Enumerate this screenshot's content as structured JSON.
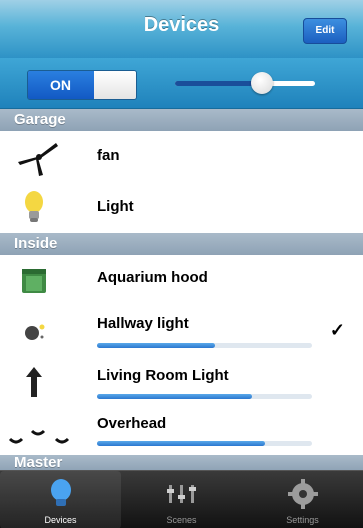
{
  "navbar": {
    "title": "Devices",
    "edit_label": "Edit"
  },
  "controls": {
    "toggle_label": "ON",
    "master_level": 0.62
  },
  "sections": [
    {
      "title": "Garage"
    },
    {
      "title": "Inside"
    },
    {
      "title": "Master"
    }
  ],
  "devices": {
    "fan": {
      "label": "fan",
      "icon": "fan-icon"
    },
    "light": {
      "label": "Light",
      "icon": "lightbulb-icon"
    },
    "aquarium": {
      "label": "Aquarium hood",
      "icon": "aquarium-icon"
    },
    "hallway": {
      "label": "Hallway light",
      "icon": "hallway-light-icon",
      "level": 0.55,
      "checked": true,
      "check_mark": "✓"
    },
    "living": {
      "label": "Living Room Light",
      "icon": "living-room-light-icon",
      "level": 0.72
    },
    "overhead": {
      "label": "Overhead",
      "icon": "overhead-light-icon",
      "level": 0.78
    }
  },
  "tabs": [
    {
      "label": "Devices",
      "icon": "bulb-icon",
      "active": true
    },
    {
      "label": "Scenes",
      "icon": "scenes-icon",
      "active": false
    },
    {
      "label": "Settings",
      "icon": "gear-icon",
      "active": false
    }
  ],
  "colors": {
    "accent": "#2e92c6",
    "section_header": "#99acbd",
    "tabbar": "#1a1a1a"
  }
}
